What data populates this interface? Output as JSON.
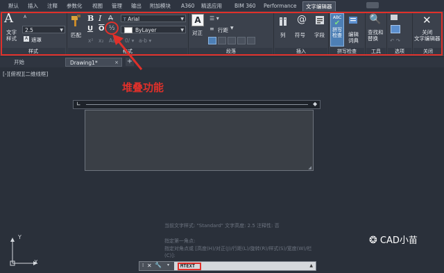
{
  "ribbon_tabs": [
    "默认",
    "插入",
    "注释",
    "参数化",
    "视图",
    "管理",
    "输出",
    "附加模块",
    "A360",
    "精选应用",
    "BIM 360",
    "Performance",
    "文字编辑器"
  ],
  "active_tab": "文字编辑器",
  "style_group": {
    "text_style_label": "文字\n样式",
    "height_value": "2.5",
    "mask_label": "遮罩",
    "group_label": "样式"
  },
  "format_group": {
    "match_label": "匹配",
    "bold_label": "B",
    "italic_label": "I",
    "underline_label": "U",
    "overline_label": "O",
    "font_value": "Arial",
    "color_value": "ByLayer",
    "superscript_label": "x²",
    "subscript_label": "x₂",
    "case_label": "Aa",
    "group_label": "格式"
  },
  "paragraph_group": {
    "justify_label": "对正",
    "line_spacing_label": "行距",
    "group_label": "段落"
  },
  "insert_group": {
    "columns_label": "列",
    "symbol_label": "符号",
    "field_label": "字段",
    "group_label": "插入"
  },
  "spell_group": {
    "spell_check_label": "拼写\n检查",
    "edit_dictionary_label": "编辑\n词典",
    "group_label": "拼写检查"
  },
  "tools_group": {
    "find_replace_label": "查找和\n替换",
    "group_label": "工具"
  },
  "options_group": {
    "group_label": "选项"
  },
  "close_group": {
    "close_label": "关闭\n文字编辑器",
    "group_label": "关闭"
  },
  "doc_tabs": [
    "开始",
    "Drawing1*"
  ],
  "active_doc_tab": "Drawing1*",
  "viewport_label": "[-][俯视][二维线框]",
  "annotation_text": "堆叠功能",
  "command_history": [
    "当前文字样式: \"Standard\"  文字高度: 2.5  注释性: 否",
    "指定第一角点:",
    "指定对角点或 [高度(H)/对正(J)/行距(L)/旋转(R)/样式(S)/宽度(W)/栏(C)]:"
  ],
  "command_input": "MTEXT",
  "watermark_text": "CAD小苗",
  "axis_labels": {
    "x": "X",
    "y": "Y"
  },
  "colors": {
    "highlight_red": "#e0302a",
    "background": "#2b313c",
    "ribbon": "#3b414c",
    "accent_blue": "#4d7fb5"
  }
}
